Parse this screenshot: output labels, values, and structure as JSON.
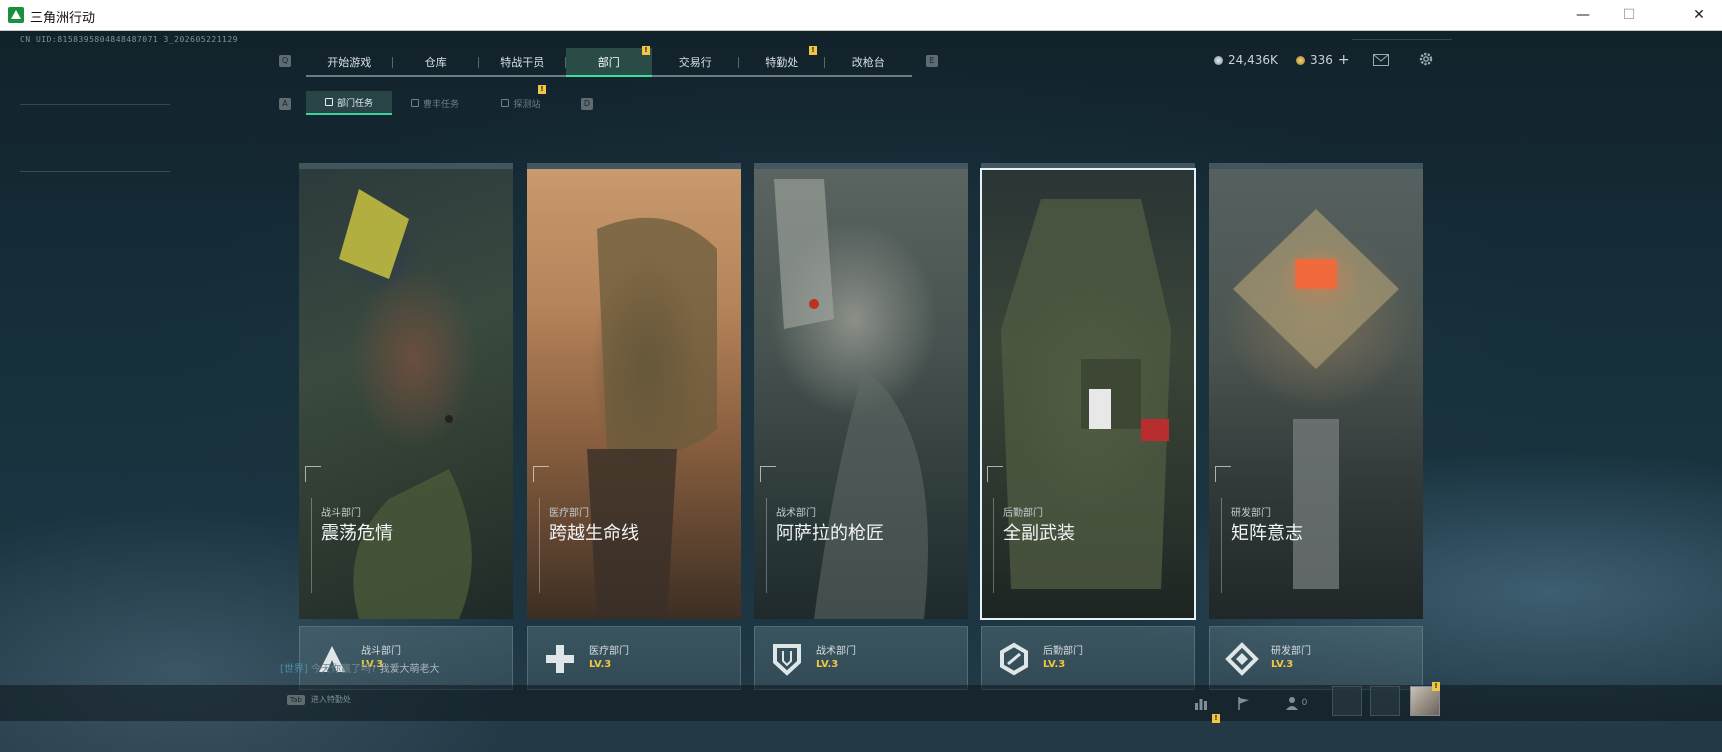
{
  "window": {
    "title": "三角洲行动",
    "minimize": "—",
    "maximize": "☐",
    "close": "✕"
  },
  "uid": "CN UID:8158395804848487071 3_202605221129",
  "nav": {
    "left_key": "Q",
    "right_key": "E",
    "tabs": [
      {
        "label": "开始游戏",
        "badge": ""
      },
      {
        "label": "仓库",
        "badge": ""
      },
      {
        "label": "特战干员",
        "badge": ""
      },
      {
        "label": "部门",
        "badge": "!",
        "active": true
      },
      {
        "label": "交易行",
        "badge": ""
      },
      {
        "label": "特勤处",
        "badge": "!"
      },
      {
        "label": "改枪台",
        "badge": ""
      }
    ]
  },
  "subnav": {
    "left_key": "A",
    "right_key": "D",
    "tabs": [
      {
        "label": "部门任务",
        "active": true,
        "badge": ""
      },
      {
        "label": "曹丰任务",
        "badge": ""
      },
      {
        "label": "探测站",
        "badge": "!"
      }
    ]
  },
  "currency": {
    "primary_value": "24,436K",
    "secondary_value": "336",
    "add_label": "+"
  },
  "departments": [
    {
      "dept": "战斗部门",
      "title": "震荡危情",
      "level": "LV.3",
      "icon": "combat-dept-icon",
      "selected": false
    },
    {
      "dept": "医疗部门",
      "title": "跨越生命线",
      "level": "LV.3",
      "icon": "medical-cross-icon",
      "selected": false
    },
    {
      "dept": "战术部门",
      "title": "阿萨拉的枪匠",
      "level": "LV.3",
      "icon": "tactical-shield-icon",
      "selected": false
    },
    {
      "dept": "后勤部门",
      "title": "全副武装",
      "level": "LV.3",
      "icon": "logistics-hex-icon",
      "selected": true
    },
    {
      "dept": "研发部门",
      "title": "矩阵意志",
      "level": "LV.3",
      "icon": "rnd-diamond-icon",
      "selected": false
    }
  ],
  "chat": {
    "channel": "[世界]",
    "message": "今天你赢了吗?",
    "extra": "我爱大萌老大"
  },
  "bottom": {
    "tab_key": "Tab",
    "tab_label": "进入特勤处",
    "friends_count": "0",
    "stats_badge": "!",
    "avatar_badge": "!"
  },
  "colors": {
    "accent": "#38e0a0",
    "badge": "#f0c642",
    "level": "#f0c642"
  }
}
